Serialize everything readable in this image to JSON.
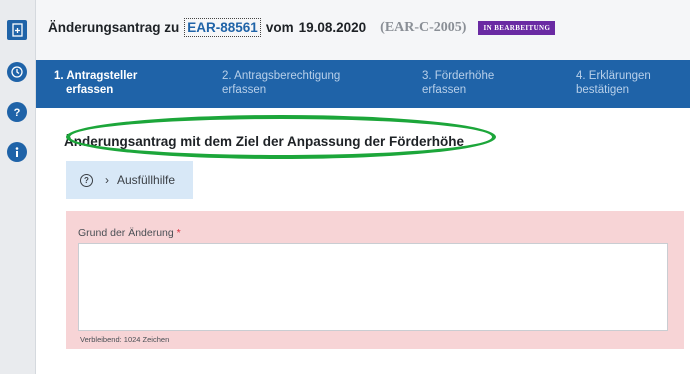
{
  "header": {
    "prefix": "Änderungsantrag zu",
    "application_id": "EAR-88561",
    "date_prefix": "vom",
    "date": "19.08.2020",
    "ref": "(EAR-C-2005)",
    "status": "IN BEARBEITUNG"
  },
  "steps": [
    {
      "line1": "1. Antragsteller",
      "line2": "erfassen"
    },
    {
      "line1": "2. Antragsberechtigung",
      "line2": "erfassen"
    },
    {
      "line1": "3. Förderhöhe",
      "line2": "erfassen"
    },
    {
      "line1": "4. Erklärungen",
      "line2": "bestätigen"
    }
  ],
  "section": {
    "title": "Änderungsantrag mit dem Ziel der Anpassung der Förderhöhe"
  },
  "help": {
    "label": "Ausfüllhilfe",
    "icon": "help-circle-icon"
  },
  "form": {
    "field_label": "Grund der Änderung",
    "required_marker": "*",
    "value": "",
    "remaining": "Verbleibend: 1024 Zeichen"
  },
  "sidebar": {
    "icons": [
      "add-icon",
      "history-icon",
      "help-icon",
      "info-icon"
    ]
  },
  "colors": {
    "primary": "#1f63a8",
    "status_badge": "#6a2aa3",
    "error_bg": "#f7d4d6",
    "highlight": "#1ca63a"
  }
}
